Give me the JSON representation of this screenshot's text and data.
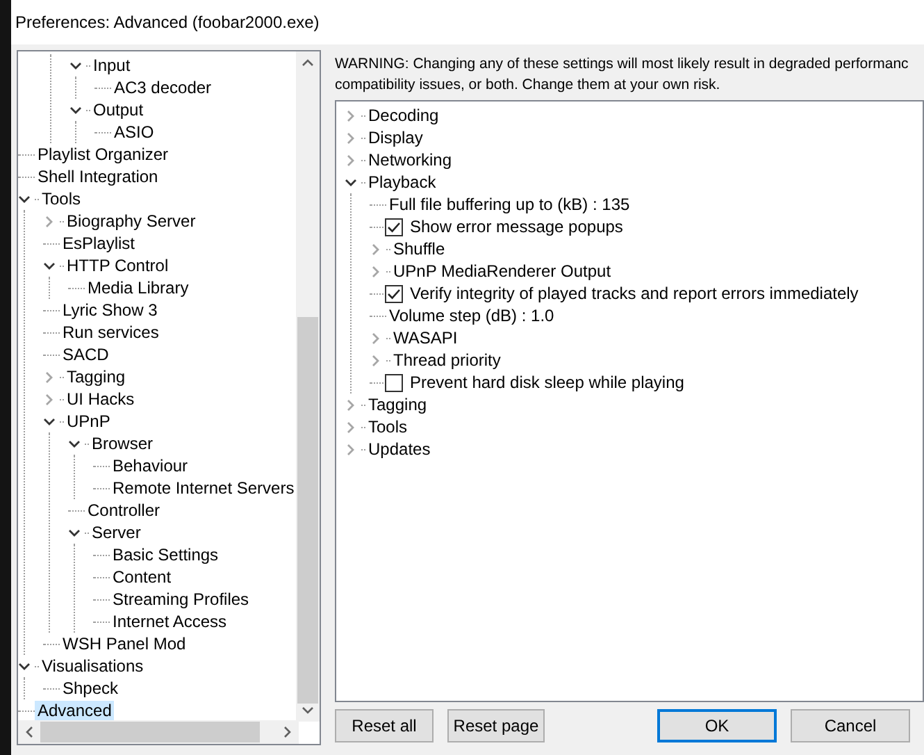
{
  "window": {
    "title": "Preferences: Advanced (foobar2000.exe)"
  },
  "nav_tree": [
    {
      "children": [
        {
          "label": "Input",
          "expanded": true,
          "selected": false,
          "children": [
            {
              "label": "AC3 decoder",
              "selected": false
            }
          ]
        },
        {
          "label": "Output",
          "expanded": true,
          "selected": false,
          "children": [
            {
              "label": "ASIO",
              "selected": false
            }
          ]
        }
      ]
    },
    {
      "label": "Playlist Organizer",
      "selected": false
    },
    {
      "label": "Shell Integration",
      "selected": false
    },
    {
      "label": "Tools",
      "expanded": true,
      "selected": false,
      "children": [
        {
          "label": "Biography Server",
          "expanded": false,
          "selected": false
        },
        {
          "label": "EsPlaylist",
          "selected": false
        },
        {
          "label": "HTTP Control",
          "expanded": true,
          "selected": false,
          "children": [
            {
              "label": "Media Library",
              "selected": false
            }
          ]
        },
        {
          "label": "Lyric Show 3",
          "selected": false
        },
        {
          "label": "Run services",
          "selected": false
        },
        {
          "label": "SACD",
          "selected": false
        },
        {
          "label": "Tagging",
          "expanded": false,
          "selected": false
        },
        {
          "label": "UI Hacks",
          "expanded": false,
          "selected": false
        },
        {
          "label": "UPnP",
          "expanded": true,
          "selected": false,
          "children": [
            {
              "label": "Browser",
              "expanded": true,
              "selected": false,
              "children": [
                {
                  "label": "Behaviour",
                  "selected": false
                },
                {
                  "label": "Remote Internet Servers",
                  "selected": false
                }
              ]
            },
            {
              "label": "Controller",
              "selected": false
            },
            {
              "label": "Server",
              "expanded": true,
              "selected": false,
              "children": [
                {
                  "label": "Basic Settings",
                  "selected": false
                },
                {
                  "label": "Content",
                  "selected": false
                },
                {
                  "label": "Streaming Profiles",
                  "selected": false
                },
                {
                  "label": "Internet Access",
                  "selected": false
                }
              ]
            }
          ]
        },
        {
          "label": "WSH Panel Mod",
          "selected": false
        }
      ]
    },
    {
      "label": "Visualisations",
      "expanded": true,
      "selected": false,
      "children": [
        {
          "label": "Shpeck",
          "selected": false
        }
      ]
    },
    {
      "label": "Advanced",
      "selected": true
    }
  ],
  "warning": "WARNING: Changing any of these settings will most likely result in degraded performanc compatibility issues, or both. Change them at your own risk.",
  "settings_tree": [
    {
      "kind": "group",
      "label": "Decoding",
      "expanded": false
    },
    {
      "kind": "group",
      "label": "Display",
      "expanded": false
    },
    {
      "kind": "group",
      "label": "Networking",
      "expanded": false
    },
    {
      "kind": "group",
      "label": "Playback",
      "expanded": true,
      "children": [
        {
          "kind": "value",
          "label": "Full file buffering up to (kB) : 135"
        },
        {
          "kind": "checkbox",
          "label": "Show error message popups",
          "checked": true
        },
        {
          "kind": "group",
          "label": "Shuffle",
          "expanded": false
        },
        {
          "kind": "group",
          "label": "UPnP MediaRenderer Output",
          "expanded": false
        },
        {
          "kind": "checkbox",
          "label": "Verify integrity of played tracks and report errors immediately",
          "checked": true
        },
        {
          "kind": "value",
          "label": "Volume step (dB) : 1.0"
        },
        {
          "kind": "group",
          "label": "WASAPI",
          "expanded": false
        },
        {
          "kind": "group",
          "label": "Thread priority",
          "expanded": false
        },
        {
          "kind": "checkbox",
          "label": "Prevent hard disk sleep while playing",
          "checked": false
        }
      ]
    },
    {
      "kind": "group",
      "label": "Tagging",
      "expanded": false
    },
    {
      "kind": "group",
      "label": "Tools",
      "expanded": false
    },
    {
      "kind": "group",
      "label": "Updates",
      "expanded": false
    }
  ],
  "buttons": [
    {
      "label": "Reset all",
      "default": false
    },
    {
      "label": "Reset page",
      "default": false
    },
    {
      "label": "OK",
      "default": true
    },
    {
      "label": "Cancel",
      "default": false
    }
  ]
}
